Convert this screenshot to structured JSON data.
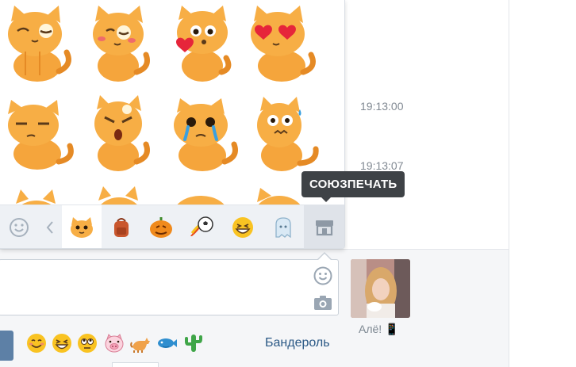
{
  "messages": {
    "timestamps": [
      "19:13:00",
      "19:13:07"
    ]
  },
  "sticker_panel": {
    "stickers": [
      "cat-wink-sticker",
      "cat-blush-wink-sticker",
      "cat-kiss-heart-sticker",
      "cat-heart-eyes-sticker",
      "cat-sad-sticker",
      "cat-angry-sticker",
      "cat-crying-sticker",
      "cat-nervous-sticker"
    ],
    "tabs": [
      "smile-icon",
      "chevron-left-icon",
      "cat-pack-icon",
      "backpack-pack-icon",
      "pumpkin-pack-icon",
      "soccer-ball-pack-icon",
      "laughing-face-pack-icon",
      "ghost-pack-icon",
      "store-icon"
    ],
    "tooltip": "СОЮЗПЕЧАТЬ"
  },
  "composer": {
    "emoji_icon": "smile-icon",
    "camera_icon": "camera-icon",
    "avatar_name": "Алё! 📱",
    "quick_emojis": [
      "smiling-face",
      "laughing-face",
      "rolling-eyes-face",
      "pig-face",
      "cat",
      "fish",
      "cactus"
    ],
    "link_label": "Бандероль"
  },
  "colors": {
    "accent": "#5d80a6",
    "link": "#2a5885",
    "tooltip_bg": "#3e4246",
    "cat_orange": "#f5a53c"
  }
}
